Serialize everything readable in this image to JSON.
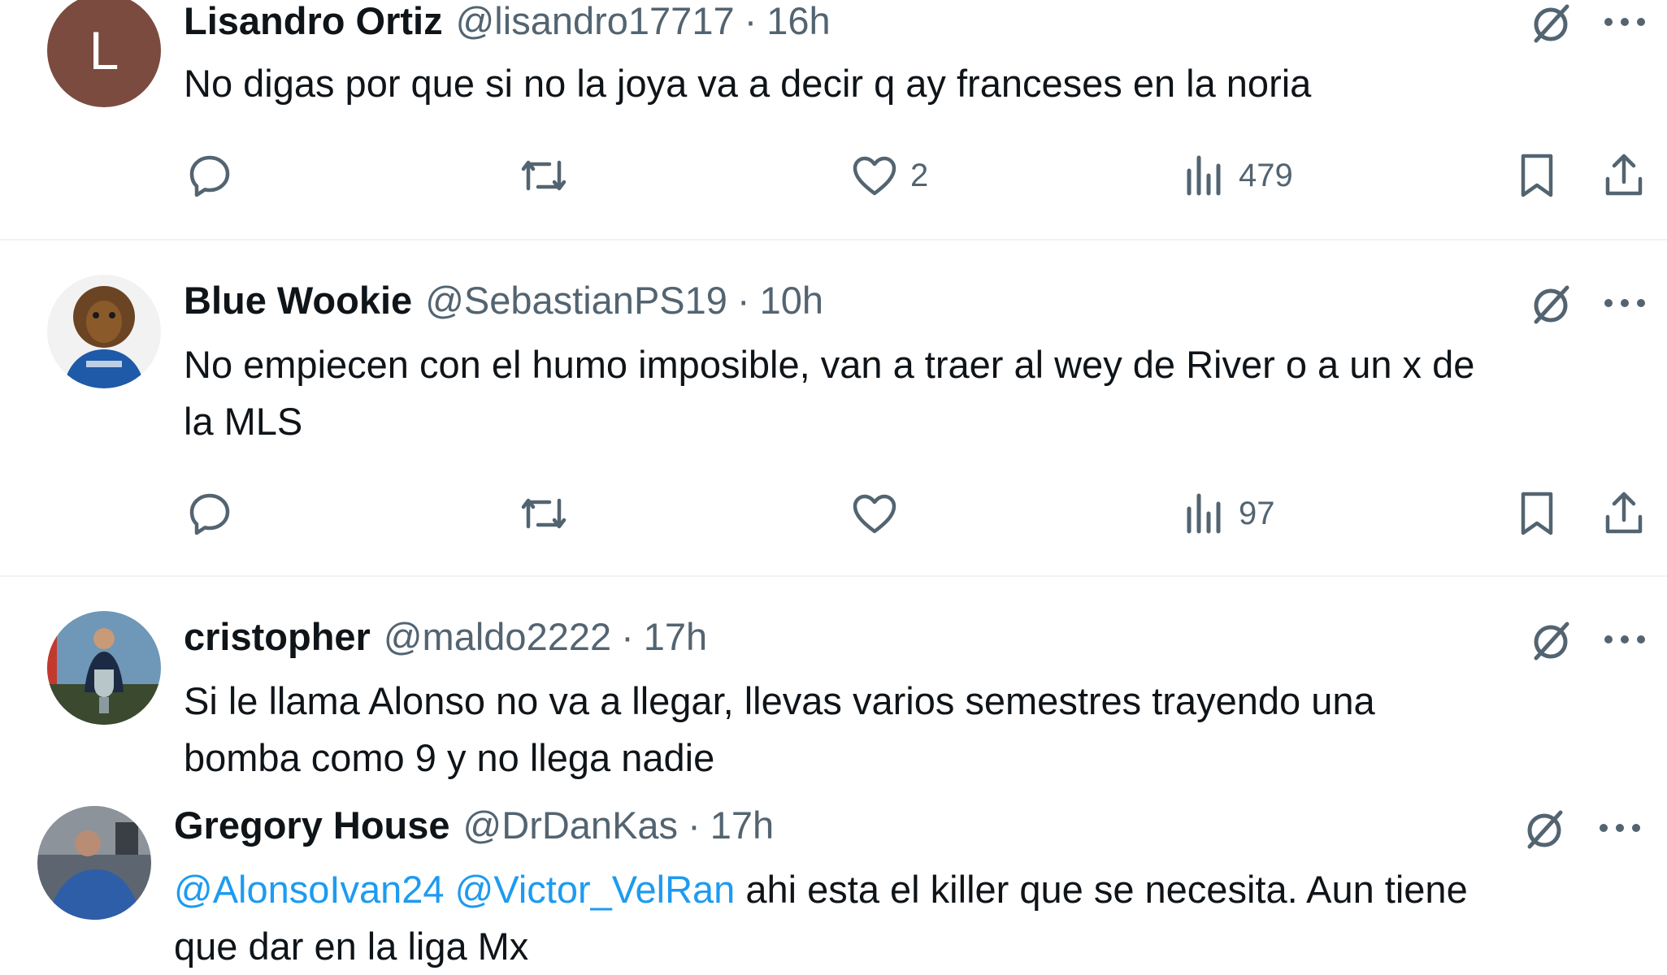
{
  "tweets": [
    {
      "display_name": "Lisandro Ortiz",
      "handle": "@lisandro17717",
      "separator": "·",
      "time": "16h",
      "avatar_letter": "L",
      "text": "No digas por que si no la joya va a decir q ay franceses en la noria",
      "replies": "",
      "retweets": "",
      "likes": "2",
      "views": "479"
    },
    {
      "display_name": "Blue Wookie",
      "handle": "@SebastianPS19",
      "separator": "·",
      "time": "10h",
      "avatar_icon": "wookie-avatar",
      "text_line1": "No empiecen con el humo imposible, van a traer al wey de River o a un x de",
      "text_line2": "la MLS",
      "replies": "",
      "retweets": "",
      "likes": "",
      "views": "97"
    },
    {
      "display_name": "cristopher",
      "handle": "@maldo2222",
      "separator": "·",
      "time": "17h",
      "avatar_icon": "trophy-photo-avatar",
      "text_line1": "Si le llama Alonso no va a llegar, llevas varios semestres trayendo una",
      "text_line2": "bomba como 9 y no llega nadie"
    },
    {
      "display_name": "Gregory House",
      "handle": "@DrDanKas",
      "separator": "·",
      "time": "17h",
      "avatar_icon": "photo-avatar",
      "mention1": "@AlonsoIvan24",
      "mention2": "@Victor_VelRan",
      "text_after_mentions": " ahi esta el killer que se necesita. Aun tiene",
      "text_line2": "que dar en la liga Mx"
    }
  ],
  "icons": {
    "reply": "reply-icon",
    "retweet": "retweet-icon",
    "like": "heart-icon",
    "views": "views-icon",
    "bookmark": "bookmark-icon",
    "share": "share-icon",
    "grok": "grok-icon",
    "more": "more-icon"
  },
  "colors": {
    "text": "#0f1419",
    "secondary": "#536471",
    "link": "#1d9bf0",
    "divider": "#eff3f4"
  }
}
